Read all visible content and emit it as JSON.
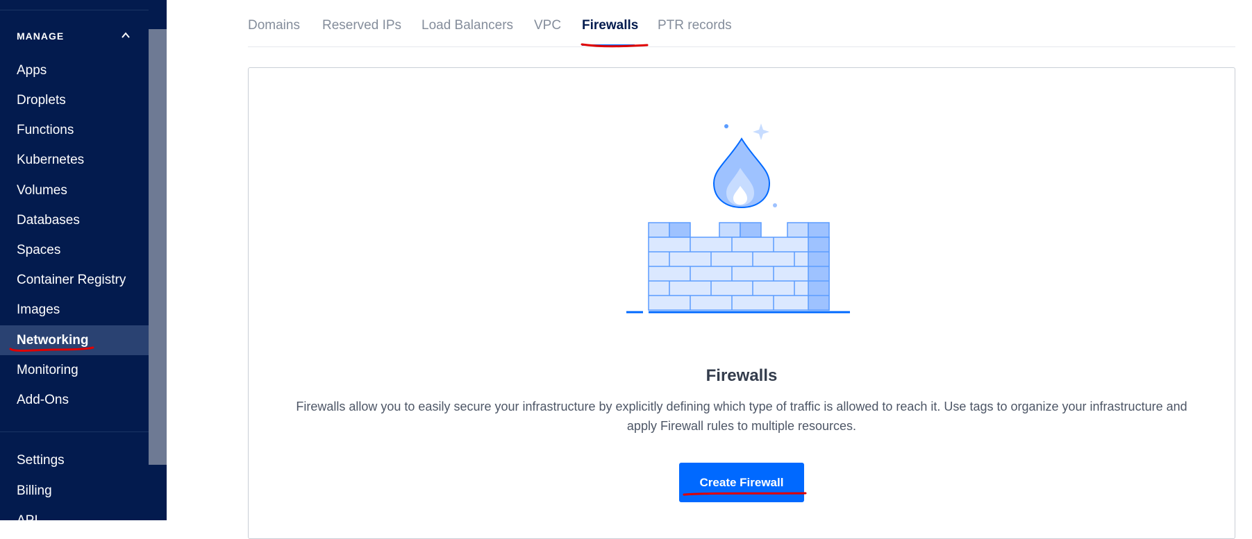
{
  "sidebar": {
    "section_title": "MANAGE",
    "items": [
      {
        "label": "Apps"
      },
      {
        "label": "Droplets"
      },
      {
        "label": "Functions"
      },
      {
        "label": "Kubernetes"
      },
      {
        "label": "Volumes"
      },
      {
        "label": "Databases"
      },
      {
        "label": "Spaces"
      },
      {
        "label": "Container Registry"
      },
      {
        "label": "Images"
      },
      {
        "label": "Networking"
      },
      {
        "label": "Monitoring"
      },
      {
        "label": "Add-Ons"
      }
    ],
    "bottom_items": [
      {
        "label": "Settings"
      },
      {
        "label": "Billing"
      },
      {
        "label": "API"
      }
    ],
    "active_item": "Networking"
  },
  "tabs": [
    {
      "label": "Domains"
    },
    {
      "label": "Reserved IPs"
    },
    {
      "label": "Load Balancers"
    },
    {
      "label": "VPC"
    },
    {
      "label": "Firewalls"
    },
    {
      "label": "PTR records"
    }
  ],
  "active_tab": "Firewalls",
  "empty_state": {
    "title": "Firewalls",
    "description": "Firewalls allow you to easily secure your infrastructure by explicitly defining which type of traffic is allowed to reach it. Use tags to organize your infrastructure and apply Firewall rules to multiple resources.",
    "button_label": "Create Firewall"
  },
  "icons": {
    "collapse": "chevron-up-icon",
    "illustration": "firewall-illustration"
  },
  "colors": {
    "sidebar_bg": "#031b4e",
    "accent": "#0069ff",
    "annotation": "#e00000"
  }
}
